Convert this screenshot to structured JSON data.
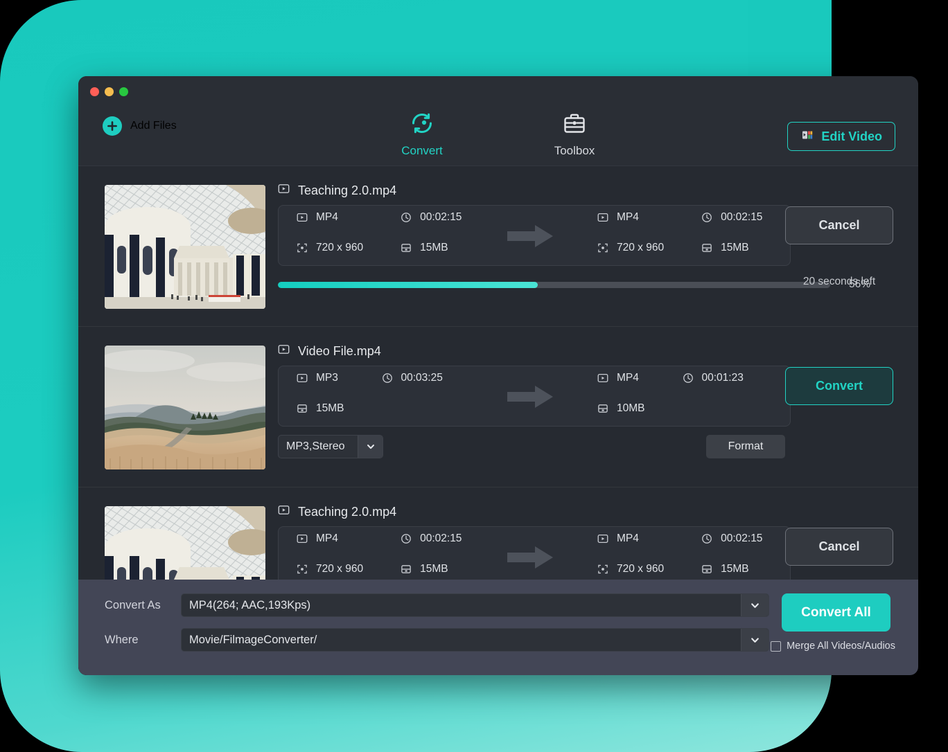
{
  "window": {
    "traffic_lights": [
      "close",
      "minimize",
      "maximize"
    ]
  },
  "toolbar": {
    "add_files_label": "Add Files",
    "tabs": [
      {
        "label": "Convert",
        "icon": "convert-refresh-icon",
        "active": true
      },
      {
        "label": "Toolbox",
        "icon": "toolbox-briefcase-icon",
        "active": false
      }
    ],
    "edit_video_label": "Edit Video",
    "edit_video_icon": "edit-video-icon",
    "accent_color": "#22d3c4"
  },
  "files": [
    {
      "name": "Teaching 2.0.mp4",
      "thumbnail": "british-museum-great-court",
      "source": {
        "format": "MP4",
        "duration": "00:02:15",
        "resolution": "720 x 960",
        "size": "15MB"
      },
      "target": {
        "format": "MP4",
        "duration": "00:02:15",
        "resolution": "720 x 960",
        "size": "15MB"
      },
      "action_label": "Cancel",
      "action_style": "cancel",
      "progress_percent": "56%",
      "progress_value": 47,
      "eta": "20 seconds left"
    },
    {
      "name": "Video File.mp4",
      "thumbnail": "rolling-hills-landscape",
      "source": {
        "format": "MP3",
        "duration": "00:03:25",
        "size": "15MB"
      },
      "target": {
        "format": "MP4",
        "duration": "00:01:23",
        "size": "10MB"
      },
      "action_label": "Convert",
      "action_style": "convert",
      "audio_preset": "MP3,Stereo",
      "format_button_label": "Format"
    },
    {
      "name": "Teaching 2.0.mp4",
      "thumbnail": "british-museum-great-court",
      "source": {
        "format": "MP4",
        "duration": "00:02:15",
        "resolution": "720 x 960",
        "size": "15MB"
      },
      "target": {
        "format": "MP4",
        "duration": "00:02:15",
        "resolution": "720 x 960",
        "size": "15MB"
      },
      "action_label": "Cancel",
      "action_style": "cancel"
    }
  ],
  "bottom_bar": {
    "convert_as_label": "Convert As",
    "convert_as_value": "MP4(264; AAC,193Kps)",
    "where_label": "Where",
    "where_value": "Movie/FilmageConverter/",
    "convert_all_label": "Convert All",
    "merge_label": "Merge All Videos/Audios",
    "merge_checked": false
  },
  "icons": {
    "file_video": "video-file-icon",
    "clock": "clock-icon",
    "resolution": "resolution-frame-icon",
    "filesize": "filesize-disk-icon",
    "arrow": "arrow-right-icon",
    "chevron": "chevron-down-icon"
  }
}
